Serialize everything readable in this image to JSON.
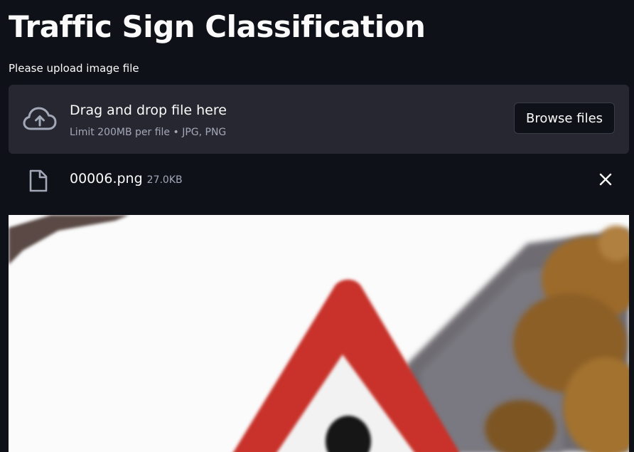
{
  "header": {
    "title": "Traffic Sign Classification"
  },
  "uploader": {
    "label": "Please upload image file",
    "drop_title": "Drag and drop file here",
    "limit_text": "Limit 200MB per file • JPG, PNG",
    "browse_label": "Browse files",
    "icon": "cloud-upload-icon"
  },
  "uploaded_file": {
    "name": "00006.png",
    "size": "27.0KB",
    "file_icon": "file-icon",
    "remove_icon": "close-icon"
  },
  "preview": {
    "description_icon": "traffic-sign-image"
  },
  "colors": {
    "background": "#0e1117",
    "panel": "#262730",
    "text": "#fafafa",
    "muted_text": "#a3a8b8",
    "sign_red": "#c8302c"
  }
}
